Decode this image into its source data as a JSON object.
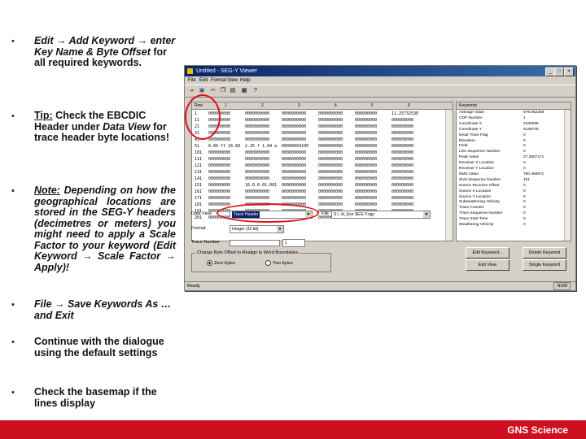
{
  "bullets": {
    "b1": {
      "pre": "Edit → Add Keyword → enter Key Name & Byte Offset",
      "post": " for all required keywords."
    },
    "b2": {
      "u": "Tip:",
      "mid": " Check the EBCDIC Header under ",
      "it": "Data View",
      "post": " for trace header byte locations!"
    },
    "b3": {
      "u": "Note:",
      "post": " Depending on how the geographical locations are stored in the SEG-Y headers (decimetres or meters) you might need to apply a Scale Factor to your keyword (Edit Keyword → Scale Factor → Apply)!"
    },
    "b4": {
      "it": "File → Save Keywords As … and Exit"
    },
    "b5": {
      "txt": "Continue with the dialogue using the default settings"
    },
    "b6": {
      "txt": "Check the basemap if the lines display"
    }
  },
  "window": {
    "title": "Untitled - SEG-Y Viewer",
    "menus": [
      "File",
      "Edit",
      "Format",
      "View",
      "Help"
    ],
    "grid": {
      "headers": [
        "Row",
        "1",
        "2",
        "3",
        "4",
        "5",
        "6"
      ],
      "rows": [
        [
          "1",
          "000000000",
          "0000000000",
          "0000000000",
          "0000000000",
          "000000000",
          "11.2573253E"
        ],
        [
          "11",
          "000000000",
          "0000000000",
          "0000000000",
          "0000000000",
          "000000000",
          "000000000"
        ],
        [
          "21",
          "000000000",
          "0000000000",
          "0000000000",
          "0000000000",
          "000000000",
          "000000000"
        ],
        [
          "31",
          "000000000",
          "0000000000",
          "0000000000",
          "0000000000",
          "000000000",
          "000000000"
        ],
        [
          "41",
          "000000000",
          "0000000000",
          "0000000000",
          "0000000000",
          "000000000",
          "000000000"
        ],
        [
          "51",
          "0.00 ff 16.60",
          "2.25 f 1.04 a",
          "00000004100",
          "0000000000",
          "000000000",
          "000000000"
        ],
        [
          "101",
          "000000000",
          "0000000000",
          "0000000000",
          "0000000000",
          "000000000",
          "000000000"
        ],
        [
          "111",
          "000000000",
          "0000000000",
          "0000000000",
          "0000000000",
          "000000000",
          "000000000"
        ],
        [
          "121",
          "000000000",
          "0000000000",
          "0000000000",
          "0000000000",
          "000000000",
          "000000000"
        ],
        [
          "131",
          "000000000",
          "0000000000",
          "0000000000",
          "0000000000",
          "000000000",
          "000000000"
        ],
        [
          "141",
          "000000000",
          "0000000000",
          "0000000000",
          "0000000000",
          "000000000",
          "000000000"
        ],
        [
          "151",
          "000000000",
          "16.0.0.01.001",
          "0000000000",
          "0000000000",
          "000000000",
          "000000000"
        ],
        [
          "161",
          "000000000",
          "0000000000",
          "0000000000",
          "0000000000",
          "000000000",
          "000000000"
        ],
        [
          "171",
          "000000000",
          "0000000000",
          "0000000000",
          "0000000000",
          "000000000",
          "000000000"
        ],
        [
          "181",
          "000000000",
          "0000000000",
          "0000000000",
          "0000000000",
          "000000000",
          "000000000"
        ],
        [
          "191",
          "000000000",
          "0000000000",
          "0000000000",
          "0000000000",
          "000000000",
          "000000000"
        ],
        [
          "201",
          "000000000",
          "0000000000",
          "0000000000",
          "0000000000",
          "000000000",
          "000000000"
        ]
      ]
    },
    "keywords": {
      "header": "Keywords",
      "rows": [
        [
          "Average Value",
          "976.952356"
        ],
        [
          "CDP Number",
          "1"
        ],
        [
          "Coordinate X",
          "2332086"
        ],
        [
          "Coordinate Y",
          "6135746"
        ],
        [
          "Dead Trace Flag",
          "0"
        ],
        [
          "Elevation",
          "0"
        ],
        [
          "Field",
          "0"
        ],
        [
          "Line Sequence Number",
          "0"
        ],
        [
          "Peak Value",
          "27.2507271"
        ],
        [
          "Receiver X Location",
          "0"
        ],
        [
          "Receiver Y Location",
          "0"
        ],
        [
          "RMS Value",
          "790.469871"
        ],
        [
          "Shot Sequence Number",
          "101"
        ],
        [
          "Source Receiver Offset",
          "0"
        ],
        [
          "Source X Location",
          "0"
        ],
        [
          "Source Y Location",
          "0"
        ],
        [
          "Subweathering Velocity",
          "0"
        ],
        [
          "Trace Counter",
          "0"
        ],
        [
          "Trace Sequence Number",
          "0"
        ],
        [
          "Trace Start Time",
          "0"
        ],
        [
          "Weathering Velocity",
          "0"
        ]
      ]
    },
    "controls": {
      "data_view_label": "Data View",
      "data_view_value": "Trace Header",
      "file_label": "File",
      "file_value": "S:\\..\\d_Exo SEG-Y.sgy",
      "format_label": "Format",
      "format_value": "Integer (32 bit)",
      "trace_number_label": "Trace Number",
      "trace_number_value": "1",
      "group_label": "Change Byte Offset to Realign to Word Boundaries",
      "radio1": "Zero bytes",
      "radio2": "Two bytes",
      "btn_edit": "Edit Keyword...",
      "btn_delete": "Delete Keyword",
      "btn_exit": "Exit View",
      "btn_single": "Single Keyword",
      "status_left": "Ready",
      "status_right": "NUM"
    }
  },
  "footer": {
    "brand": "GNS Science"
  },
  "colors": {
    "accent": "#cc1020",
    "highlight": "#e3101b",
    "titlebar": "#0a246a"
  }
}
